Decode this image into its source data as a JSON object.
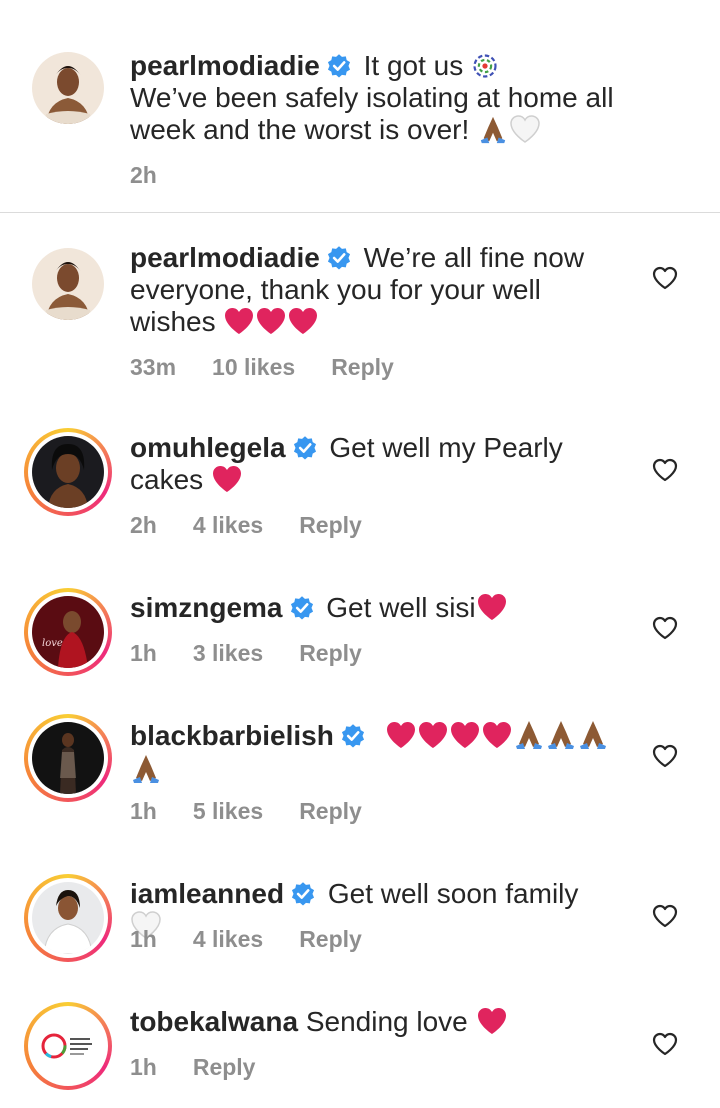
{
  "caption": {
    "username": "pearlmodiadie",
    "text_prefix": "It got us",
    "text_body": "We’ve been safely isolating at home all week and the worst is over!",
    "time": "2h"
  },
  "comments": [
    {
      "username": "pearlmodiadie",
      "text": "We’re all fine now everyone, thank you for your well wishes",
      "time": "33m",
      "likes": "10 likes",
      "reply": "Reply"
    },
    {
      "username": "omuhlegela",
      "text": "Get well my Pearly cakes",
      "time": "2h",
      "likes": "4 likes",
      "reply": "Reply"
    },
    {
      "username": "simzngema",
      "text": "Get well sisi",
      "time": "1h",
      "likes": "3 likes",
      "reply": "Reply"
    },
    {
      "username": "blackbarbielish",
      "text": "",
      "time": "1h",
      "likes": "5 likes",
      "reply": "Reply"
    },
    {
      "username": "iamleanned",
      "text": "Get well soon family",
      "time": "1h",
      "likes": "4 likes",
      "reply": "Reply"
    },
    {
      "username": "tobekalwana",
      "text": "Sending love",
      "time": "1h",
      "reply": "Reply"
    }
  ],
  "colors": {
    "text": "#262626",
    "meta": "#8e8e8e",
    "verified": "#3897f0",
    "heart_emoji": "#e0245e",
    "divider": "#dbdbdb"
  },
  "icons": [
    "verified-badge-icon",
    "like-heart-outline-icon",
    "red-heart-emoji",
    "praying-hands-emoji",
    "white-heart-emoji",
    "vaccine-ribbon-emoji"
  ]
}
